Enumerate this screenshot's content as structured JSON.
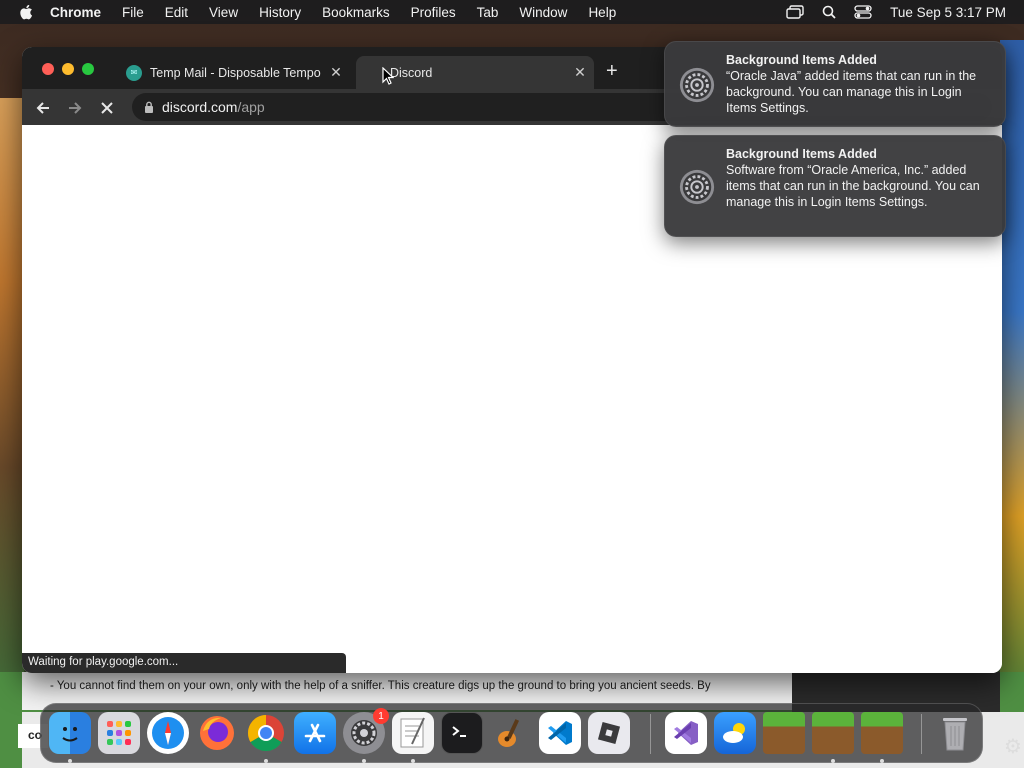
{
  "menubar": {
    "app_name": "Chrome",
    "items": [
      "File",
      "Edit",
      "View",
      "History",
      "Bookmarks",
      "Profiles",
      "Tab",
      "Window",
      "Help"
    ],
    "clock": "Tue Sep 5  3:17 PM"
  },
  "browser": {
    "tabs": [
      {
        "title": "Temp Mail - Disposable Tempo",
        "active": false
      },
      {
        "title": "Discord",
        "active": true
      }
    ],
    "url": {
      "host": "discord.com",
      "path": "/app"
    },
    "status": "Waiting for play.google.com..."
  },
  "notifications": [
    {
      "title": "Background Items Added",
      "body": "“Oracle Java” added items that can run in the background. You can manage this in Login Items Settings."
    },
    {
      "title": "Background Items Added",
      "body": "Software from “Oracle America, Inc.” added items that can run in the background. You can manage this in Login Items Settings."
    }
  ],
  "background": {
    "article_text": "- You cannot find them on your own, only with the help of a sniffer. This creature digs up the ground to bring you ancient seeds. By",
    "co_label": "co"
  },
  "dock": {
    "system_settings_badge": "1",
    "icons": [
      "finder-icon",
      "launchpad-icon",
      "safari-icon",
      "firefox-icon",
      "chrome-icon",
      "app-store-icon",
      "system-settings-icon",
      "textedit-icon",
      "terminal-icon",
      "garageband-icon",
      "vscode-icon",
      "roblox-icon",
      "visual-studio-icon",
      "weather-icon",
      "minecraft-icon",
      "minecraft-icon",
      "minecraft-icon",
      "trash-icon"
    ]
  },
  "colors": {
    "accent_red": "#ff5f57",
    "accent_yellow": "#febc2e",
    "accent_green": "#28c840"
  }
}
